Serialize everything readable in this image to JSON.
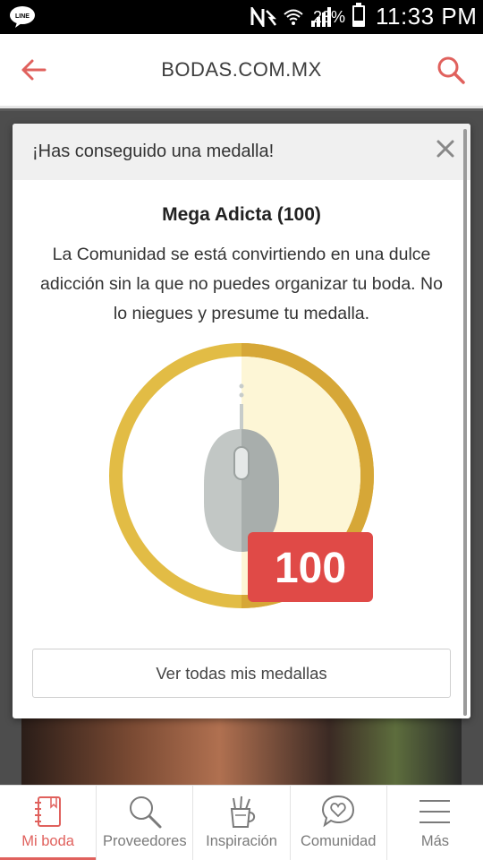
{
  "status_bar": {
    "line_app": "LINE",
    "battery_percent": "23%",
    "time": "11:33 PM"
  },
  "app_bar": {
    "title": "BODAS.COM.MX",
    "back_icon": "back-arrow-icon",
    "search_icon": "search-icon"
  },
  "modal": {
    "header": "¡Has conseguido una medalla!",
    "medal_name": "Mega Adicta (100)",
    "description": "La Comunidad se está convirtiendo en una dulce adicción sin la que no puedes organizar tu boda. No lo niegues y presume tu medalla.",
    "medal_badge": "100",
    "button_label": "Ver todas mis medallas"
  },
  "bottom_nav": {
    "items": [
      {
        "label": "Mi boda",
        "icon": "notebook-icon",
        "active": true
      },
      {
        "label": "Proveedores",
        "icon": "search-icon",
        "active": false
      },
      {
        "label": "Inspiración",
        "icon": "cup-pencils-icon",
        "active": false
      },
      {
        "label": "Comunidad",
        "icon": "chat-heart-icon",
        "active": false
      },
      {
        "label": "Más",
        "icon": "hamburger-menu-icon",
        "active": false
      }
    ]
  },
  "colors": {
    "accent": "#e0615d",
    "medal_gold": "#e0b63c",
    "badge_red": "#e04a47"
  }
}
